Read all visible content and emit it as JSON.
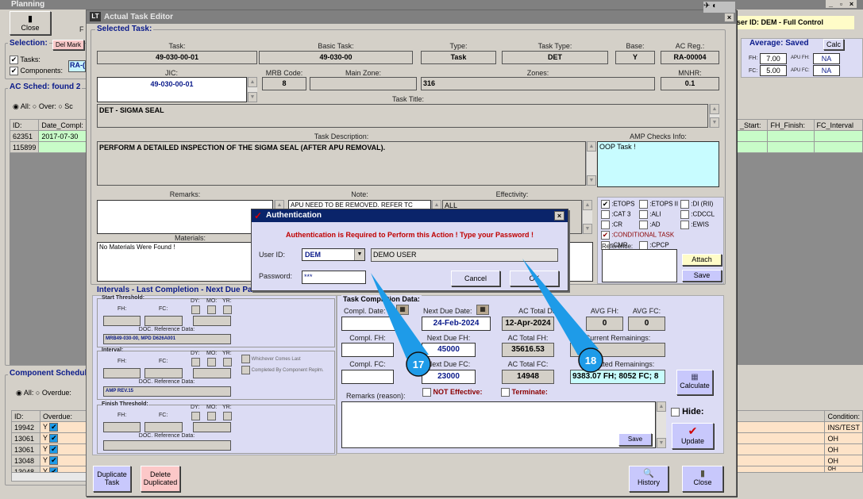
{
  "planning": {
    "title": "Planning",
    "close_label": "Close",
    "toolbar_cut": "F",
    "user_banner": "ser ID: DEM - Full Control",
    "selection": {
      "title": "Selection:",
      "del_mark": "Del Mark",
      "tasks": "Tasks:",
      "components": "Components:",
      "ac_reg": "RA-("
    },
    "ac_sched": {
      "title": "AC Sched: found  2",
      "radio_all": "All:",
      "radio_over": "Over:",
      "radio_sc": "Sc",
      "headers": [
        "ID:",
        "Date_Compl:"
      ],
      "rows": [
        [
          "62351",
          "2017-07-30"
        ],
        [
          "115899",
          ""
        ]
      ],
      "right_headers": [
        "_Start:",
        "FH_Finish:",
        "FC_Interval"
      ]
    },
    "average": {
      "title": "Average: Saved",
      "calc": "Calc",
      "fh_label": "FH:",
      "fh": "7.00",
      "fc_label": "FC:",
      "fc": "5.00",
      "apu_fh_label": "APU FH:",
      "apu_fh": "NA",
      "apu_fc_label": "APU FC:",
      "apu_fc": "NA"
    },
    "component": {
      "title": "Component Schedul",
      "radio_all": "All:",
      "radio_overdue": "Overdue:",
      "headers": [
        "ID:",
        "Overdue:"
      ],
      "rows": [
        [
          "19942",
          "Y"
        ],
        [
          "13061",
          "Y"
        ],
        [
          "13061",
          "Y"
        ],
        [
          "13048",
          "Y"
        ],
        [
          "13048",
          "Y"
        ]
      ],
      "condition_header": "Condition:",
      "conditions": [
        "INS/TEST",
        "OH",
        "OH",
        "OH",
        "OH"
      ]
    }
  },
  "editor": {
    "title": "Actual Task Editor",
    "selected_task": "Selected Task:",
    "fields": {
      "task": {
        "label": "Task:",
        "value": "49-030-00-01"
      },
      "basic_task": {
        "label": "Basic Task:",
        "value": "49-030-00"
      },
      "type": {
        "label": "Type:",
        "value": "Task"
      },
      "task_type": {
        "label": "Task Type:",
        "value": "DET"
      },
      "base": {
        "label": "Base:",
        "value": "Y"
      },
      "ac_reg": {
        "label": "AC Reg.:",
        "value": "RA-00004"
      },
      "jic": {
        "label": "JIC:",
        "value": "49-030-00-01"
      },
      "mrb": {
        "label": "MRB Code:",
        "value": "8"
      },
      "main_zone": {
        "label": "Main Zone:",
        "value": ""
      },
      "zones": {
        "label": "Zones:",
        "value": "316"
      },
      "mnhr": {
        "label": "MNHR:",
        "value": "0.1"
      },
      "task_title": {
        "label": "Task Title:",
        "value": "DET - SIGMA SEAL"
      },
      "description": {
        "label": "Task Description:",
        "value": "PERFORM A DETAILED INSPECTION OF THE SIGMA SEAL (AFTER APU REMOVAL)."
      },
      "amp": {
        "label": "AMP Checks Info:",
        "value": "OOP Task !"
      },
      "remarks": {
        "label": "Remarks:",
        "value": ""
      },
      "note": {
        "label": "Note:",
        "value": "APU NEED TO BE REMOVED. REFER TC"
      },
      "effectivity": {
        "label": "Effectivity:",
        "value": "ALL"
      },
      "materials": {
        "label": "Materials:",
        "value": "No Materials Were Found !"
      }
    },
    "checks": [
      {
        "label": ":ETOPS",
        "checked": true
      },
      {
        "label": ":ETOPS II",
        "checked": false
      },
      {
        "label": ":DI (RII)",
        "checked": false
      },
      {
        "label": ":CAT 3",
        "checked": false
      },
      {
        "label": ":ALI",
        "checked": false
      },
      {
        "label": ":CDCCL",
        "checked": false
      },
      {
        "label": ":CR",
        "checked": false
      },
      {
        "label": ":AD",
        "checked": false
      },
      {
        "label": ":EWIS",
        "checked": false
      },
      {
        "label": ":CONDITIONAL TASK",
        "checked": true
      },
      {
        "label": ":CMR",
        "checked": false
      },
      {
        "label": ":CPCP",
        "checked": false
      }
    ],
    "reference_label": "Reference:",
    "attach": "Attach",
    "save": "Save",
    "intervals": {
      "title": "Intervals - Last Completion - Next Due Para",
      "start": "Start Threshold:",
      "interval": "Interval:",
      "finish": "Finish Threshold:",
      "fh": "FH:",
      "fc": "FC:",
      "dy": "DY:",
      "mo": "MO:",
      "yr": "YR:",
      "doc": "DOC. Reference Data:",
      "start_doc": "MRB49-030-00, MPD D626A001",
      "interval_doc": "AMP REV.15",
      "whichever": "Whichever Comes Last",
      "completed_by": "Completed By Component Replm."
    },
    "completion": {
      "title": "Task Completion Data:",
      "compl_date": "Compl. Date:",
      "next_due_date_label": "Next Due Date:",
      "next_due_date": "24-Feb-2024",
      "ac_total_date_label": "AC Total Date:",
      "ac_total_date": "12-Apr-2024",
      "avg_fh_label": "AVG FH:",
      "avg_fh": "0",
      "avg_fc_label": "AVG FC:",
      "avg_fc": "0",
      "compl_fh": "Compl. FH:",
      "next_due_fh_label": "Next Due FH:",
      "next_due_fh": "45000",
      "ac_total_fh_label": "AC Total FH:",
      "ac_total_fh": "35616.53",
      "current_rem": "Current Remainings:",
      "compl_fc": "Compl. FC:",
      "next_due_fc_label": "Next Due FC:",
      "next_due_fc": "23000",
      "ac_total_fc_label": "AC Total FC:",
      "ac_total_fc": "14948",
      "est_rem_label": "Estimated Remainings:",
      "est_rem": "9383.07 FH;  8052 FC;  8",
      "calculate": "Calculate",
      "remarks_reason": "Remarks (reason):",
      "not_effective": "NOT Effective:",
      "terminate": "Terminate:",
      "save": "Save",
      "hide": "Hide:",
      "update": "Update"
    },
    "bottom": {
      "duplicate": [
        "Duplicate",
        "Task"
      ],
      "delete_dup": [
        "Delete",
        "Duplicated"
      ],
      "history": "History",
      "close": "Close"
    }
  },
  "auth": {
    "title": "Authentication",
    "message": "Authentication is Required to Perform this Action ! Type your Password !",
    "user_id_label": "User ID:",
    "user_id": "DEM",
    "user_name": "DEMO USER",
    "password_label": "Password:",
    "password": "***",
    "cancel": "Cancel",
    "ok": "OK"
  },
  "callouts": {
    "c17": "17",
    "c18": "18"
  },
  "colors": {
    "callout": "#1e9be8",
    "title_inactive": "#808080",
    "dialog_title": "#0a246a",
    "alert": "#c00000"
  }
}
